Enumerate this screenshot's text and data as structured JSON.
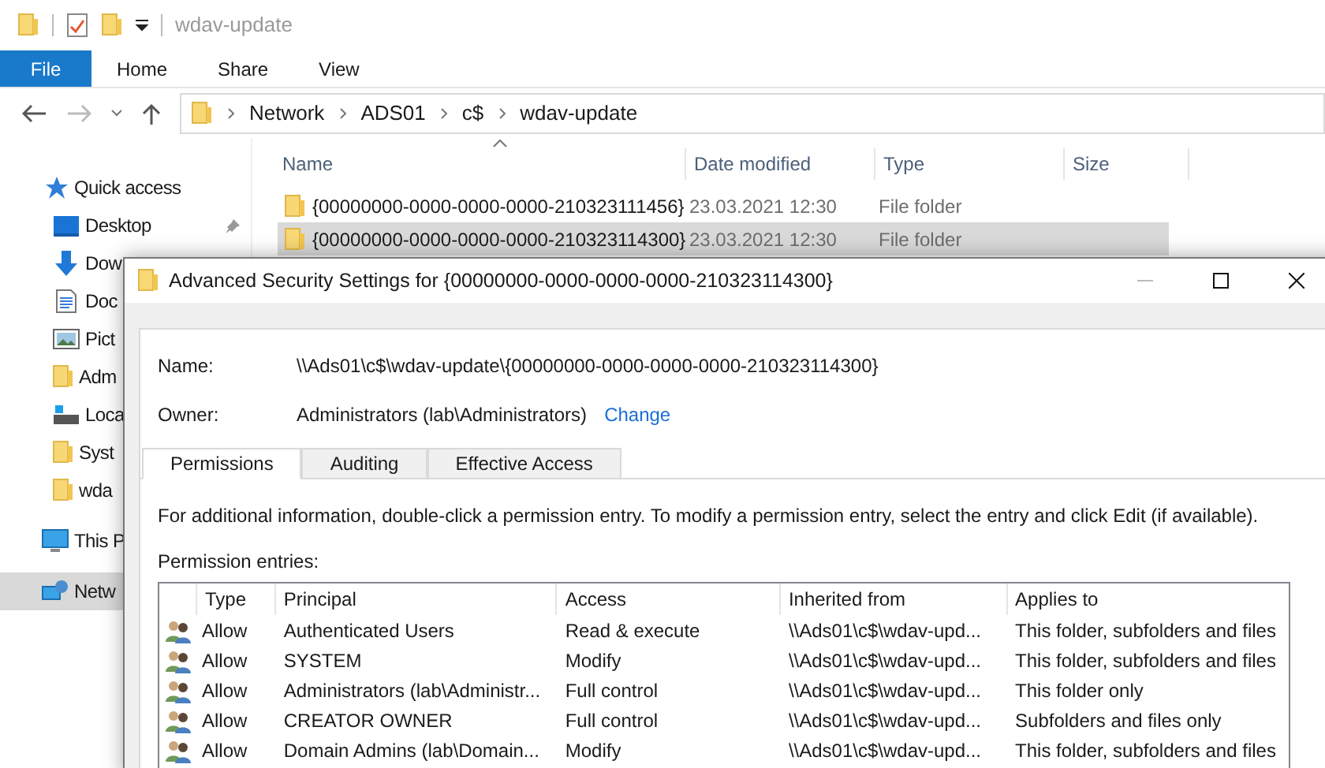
{
  "window": {
    "title": "wdav-update"
  },
  "ribbon_tabs": [
    {
      "label": "File",
      "kind": "file"
    },
    {
      "label": "Home",
      "kind": "tab"
    },
    {
      "label": "Share",
      "kind": "tab"
    },
    {
      "label": "View",
      "kind": "tab"
    }
  ],
  "address": {
    "segments": [
      "Network",
      "ADS01",
      "c$",
      "wdav-update"
    ]
  },
  "navigation": [
    {
      "label": "Quick access",
      "kind": "star",
      "pinned": false,
      "selected": false
    },
    {
      "label": "Desktop",
      "kind": "desktop",
      "pinned": true,
      "selected": false
    },
    {
      "label": "Dow",
      "kind": "download",
      "selected": false
    },
    {
      "label": "Doc",
      "kind": "document",
      "selected": false
    },
    {
      "label": "Pict",
      "kind": "picture",
      "selected": false
    },
    {
      "label": "Adm",
      "kind": "folder",
      "selected": false
    },
    {
      "label": "Loca",
      "kind": "drive",
      "selected": false
    },
    {
      "label": "Syst",
      "kind": "folder",
      "selected": false
    },
    {
      "label": "wda",
      "kind": "folder",
      "selected": false
    },
    {
      "label": "This P",
      "kind": "pc",
      "selected": false
    },
    {
      "label": "Netw",
      "kind": "network",
      "selected": true
    }
  ],
  "files": {
    "columns": [
      "Name",
      "Date modified",
      "Type",
      "Size"
    ],
    "rows": [
      {
        "name": "{00000000-0000-0000-0000-210323111456}",
        "date": "23.03.2021 12:30",
        "type": "File folder",
        "selected": false
      },
      {
        "name": "{00000000-0000-0000-0000-210323114300}",
        "date": "23.03.2021 12:30",
        "type": "File folder",
        "selected": true
      }
    ]
  },
  "dialog": {
    "title": "Advanced Security Settings for {00000000-0000-0000-0000-210323114300}",
    "name_label": "Name:",
    "name_value": "\\\\Ads01\\c$\\wdav-update\\{00000000-0000-0000-0000-210323114300}",
    "owner_label": "Owner:",
    "owner_value": "Administrators (lab\\Administrators)",
    "change_link": "Change",
    "tabs": [
      {
        "label": "Permissions",
        "selected": true
      },
      {
        "label": "Auditing",
        "selected": false
      },
      {
        "label": "Effective Access",
        "selected": false
      }
    ],
    "info": "For additional information, double-click a permission entry. To modify a permission entry, select the entry and click Edit (if available).",
    "entries_label": "Permission entries:",
    "columns": [
      "Type",
      "Principal",
      "Access",
      "Inherited from",
      "Applies to"
    ],
    "rows": [
      {
        "type": "Allow",
        "principal": "Authenticated Users",
        "access": "Read & execute",
        "inherited_from": "\\\\Ads01\\c$\\wdav-upd...",
        "applies_to": "This folder, subfolders and files"
      },
      {
        "type": "Allow",
        "principal": "SYSTEM",
        "access": "Modify",
        "inherited_from": "\\\\Ads01\\c$\\wdav-upd...",
        "applies_to": "This folder, subfolders and files"
      },
      {
        "type": "Allow",
        "principal": "Administrators (lab\\Administr...",
        "access": "Full control",
        "inherited_from": "\\\\Ads01\\c$\\wdav-upd...",
        "applies_to": "This folder only"
      },
      {
        "type": "Allow",
        "principal": "CREATOR OWNER",
        "access": "Full control",
        "inherited_from": "\\\\Ads01\\c$\\wdav-upd...",
        "applies_to": "Subfolders and files only"
      },
      {
        "type": "Allow",
        "principal": "Domain Admins (lab\\Domain...",
        "access": "Modify",
        "inherited_from": "\\\\Ads01\\c$\\wdav-upd...",
        "applies_to": "This folder, subfolders and files"
      }
    ]
  }
}
